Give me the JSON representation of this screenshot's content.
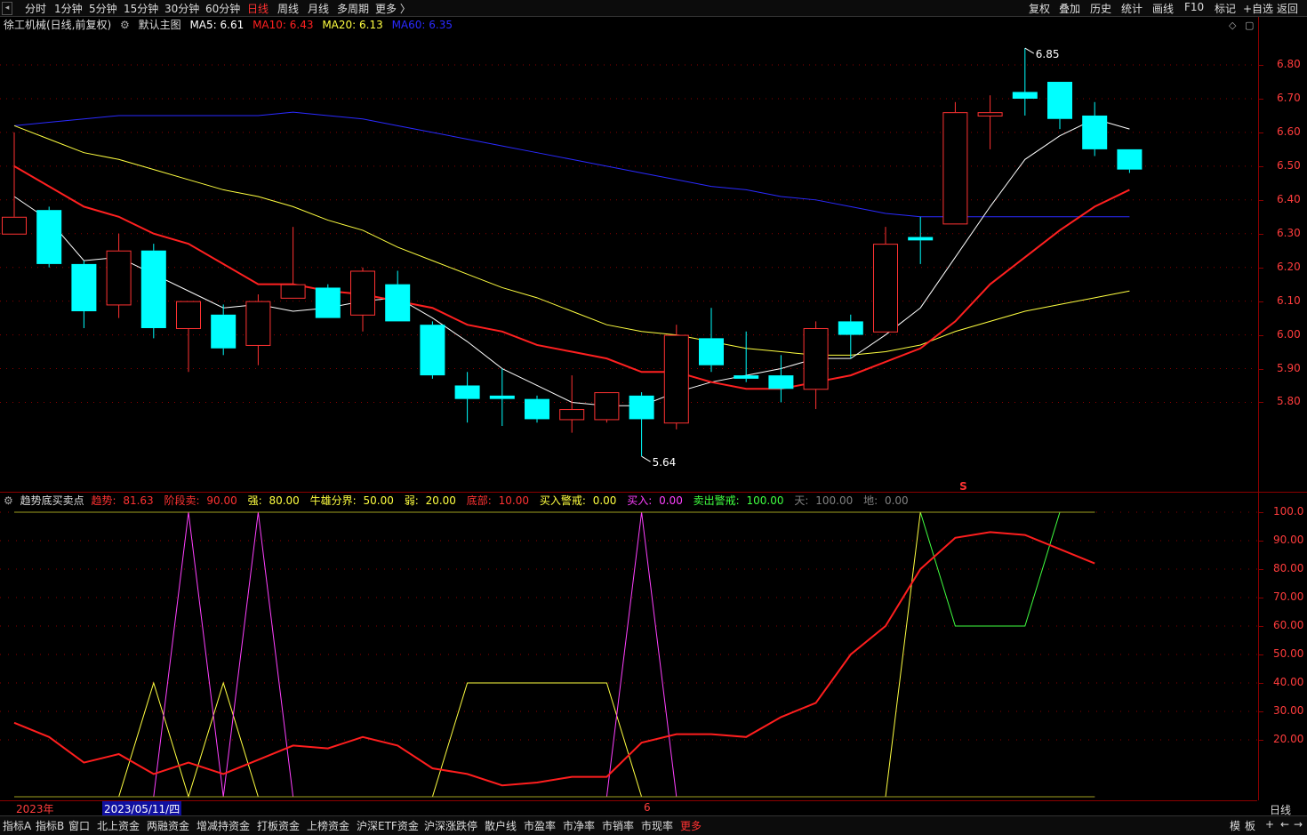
{
  "topbar": {
    "periods": [
      "分时",
      "1分钟",
      "5分钟",
      "15分钟",
      "30分钟",
      "60分钟",
      "日线",
      "周线",
      "月线",
      "多周期",
      "更多 〉"
    ],
    "active_period": "日线",
    "right_tools": [
      "复权",
      "叠加",
      "历史",
      "统计",
      "画线",
      "F10",
      "标记",
      "+自选",
      "返回"
    ]
  },
  "main_info": {
    "stock_title": "徐工机械(日线,前复权)",
    "template_label": "默认主图",
    "ma5": "MA5: 6.61",
    "ma10": "MA10: 6.43",
    "ma20": "MA20: 6.13",
    "ma60": "MA60: 6.35"
  },
  "colors": {
    "up": "#ff3232",
    "down": "#00ffff",
    "ma5": "#ffffff",
    "ma10": "#ff2020",
    "ma20": "#ffff40",
    "ma60": "#2a2aff",
    "grid": "#8b0000",
    "axis_text": "#ff3c3c"
  },
  "price_axis": {
    "labels": [
      "6.80",
      "6.70",
      "6.60",
      "6.50",
      "6.40",
      "6.30",
      "6.20",
      "6.10",
      "6.00",
      "5.90",
      "5.80"
    ],
    "high_marker": "6.85",
    "low_marker": "5.64",
    "signal_mark": "S"
  },
  "chart_data": {
    "type": "candlestick",
    "x_label_start": "2023年",
    "x_cursor_date": "2023/05/11/四",
    "x_month_mark": "6",
    "candles": [
      {
        "o": 6.3,
        "h": 6.6,
        "l": 6.3,
        "c": 6.35
      },
      {
        "o": 6.37,
        "h": 6.38,
        "l": 6.2,
        "c": 6.21
      },
      {
        "o": 6.21,
        "h": 6.22,
        "l": 6.02,
        "c": 6.07
      },
      {
        "o": 6.09,
        "h": 6.3,
        "l": 6.05,
        "c": 6.25
      },
      {
        "o": 6.25,
        "h": 6.27,
        "l": 5.99,
        "c": 6.02
      },
      {
        "o": 6.02,
        "h": 6.1,
        "l": 5.89,
        "c": 6.1
      },
      {
        "o": 6.06,
        "h": 6.09,
        "l": 5.94,
        "c": 5.96
      },
      {
        "o": 5.97,
        "h": 6.12,
        "l": 5.91,
        "c": 6.1
      },
      {
        "o": 6.11,
        "h": 6.32,
        "l": 6.11,
        "c": 6.15
      },
      {
        "o": 6.14,
        "h": 6.15,
        "l": 6.05,
        "c": 6.05
      },
      {
        "o": 6.06,
        "h": 6.2,
        "l": 6.01,
        "c": 6.19
      },
      {
        "o": 6.15,
        "h": 6.19,
        "l": 6.04,
        "c": 6.04
      },
      {
        "o": 6.03,
        "h": 6.04,
        "l": 5.87,
        "c": 5.88
      },
      {
        "o": 5.85,
        "h": 5.89,
        "l": 5.74,
        "c": 5.81
      },
      {
        "o": 5.82,
        "h": 5.9,
        "l": 5.73,
        "c": 5.81
      },
      {
        "o": 5.81,
        "h": 5.82,
        "l": 5.74,
        "c": 5.75
      },
      {
        "o": 5.75,
        "h": 5.88,
        "l": 5.71,
        "c": 5.78
      },
      {
        "o": 5.75,
        "h": 5.83,
        "l": 5.74,
        "c": 5.83
      },
      {
        "o": 5.82,
        "h": 5.83,
        "l": 5.64,
        "c": 5.75
      },
      {
        "o": 5.74,
        "h": 6.03,
        "l": 5.72,
        "c": 6.0
      },
      {
        "o": 5.99,
        "h": 6.08,
        "l": 5.89,
        "c": 5.91
      },
      {
        "o": 5.88,
        "h": 6.01,
        "l": 5.86,
        "c": 5.87
      },
      {
        "o": 5.88,
        "h": 5.94,
        "l": 5.8,
        "c": 5.84
      },
      {
        "o": 5.84,
        "h": 6.04,
        "l": 5.78,
        "c": 6.02
      },
      {
        "o": 6.04,
        "h": 6.06,
        "l": 5.93,
        "c": 6.0
      },
      {
        "o": 6.01,
        "h": 6.32,
        "l": 6.01,
        "c": 6.27
      },
      {
        "o": 6.29,
        "h": 6.35,
        "l": 6.21,
        "c": 6.28
      },
      {
        "o": 6.33,
        "h": 6.69,
        "l": 6.33,
        "c": 6.66
      },
      {
        "o": 6.65,
        "h": 6.71,
        "l": 6.55,
        "c": 6.66
      },
      {
        "o": 6.72,
        "h": 6.85,
        "l": 6.65,
        "c": 6.7
      },
      {
        "o": 6.75,
        "h": 6.75,
        "l": 6.61,
        "c": 6.64
      },
      {
        "o": 6.65,
        "h": 6.69,
        "l": 6.53,
        "c": 6.55
      },
      {
        "o": 6.55,
        "h": 6.55,
        "l": 6.48,
        "c": 6.49
      }
    ],
    "ma5": [
      6.41,
      6.34,
      6.22,
      6.23,
      6.18,
      6.13,
      6.08,
      6.09,
      6.07,
      6.08,
      6.1,
      6.11,
      6.05,
      5.98,
      5.9,
      5.85,
      5.8,
      5.79,
      5.79,
      5.83,
      5.86,
      5.88,
      5.9,
      5.93,
      5.93,
      6.0,
      6.08,
      6.23,
      6.38,
      6.52,
      6.59,
      6.64,
      6.61
    ],
    "ma10": [
      6.5,
      6.44,
      6.38,
      6.35,
      6.3,
      6.27,
      6.21,
      6.15,
      6.15,
      6.13,
      6.12,
      6.1,
      6.08,
      6.03,
      6.01,
      5.97,
      5.95,
      5.93,
      5.89,
      5.89,
      5.86,
      5.84,
      5.84,
      5.86,
      5.88,
      5.92,
      5.96,
      6.04,
      6.15,
      6.23,
      6.31,
      6.38,
      6.43
    ],
    "ma20": [
      6.62,
      6.58,
      6.54,
      6.52,
      6.49,
      6.46,
      6.43,
      6.41,
      6.38,
      6.34,
      6.31,
      6.26,
      6.22,
      6.18,
      6.14,
      6.11,
      6.07,
      6.03,
      6.01,
      6.0,
      5.98,
      5.96,
      5.95,
      5.94,
      5.94,
      5.95,
      5.97,
      6.01,
      6.04,
      6.07,
      6.09,
      6.11,
      6.13
    ],
    "ma60": [
      6.62,
      6.63,
      6.64,
      6.65,
      6.65,
      6.65,
      6.65,
      6.65,
      6.66,
      6.65,
      6.64,
      6.62,
      6.6,
      6.58,
      6.56,
      6.54,
      6.52,
      6.5,
      6.48,
      6.46,
      6.44,
      6.43,
      6.41,
      6.4,
      6.38,
      6.36,
      6.35,
      6.35,
      6.35,
      6.35,
      6.35,
      6.35,
      6.35
    ],
    "price_range": [
      5.535,
      6.895
    ],
    "indicator": {
      "range": [
        0,
        100
      ],
      "trend": [
        26,
        21,
        12,
        15,
        8,
        12,
        8,
        13,
        18,
        17,
        21,
        18,
        10,
        8,
        4,
        5,
        7,
        7,
        19,
        22,
        22,
        21,
        28,
        33,
        50,
        60,
        80,
        91,
        93,
        92,
        87,
        82
      ],
      "yellow": [
        0,
        0,
        0,
        0,
        40,
        0,
        40,
        0,
        0,
        0,
        0,
        0,
        0,
        40,
        40,
        40,
        40,
        40,
        0,
        0,
        0,
        0,
        0,
        0,
        0,
        0,
        100,
        100,
        100,
        100,
        100,
        100
      ],
      "magenta": [
        0,
        0,
        0,
        0,
        0,
        100,
        0,
        100,
        0,
        0,
        0,
        0,
        0,
        0,
        0,
        0,
        0,
        0,
        100,
        0,
        0,
        0,
        0,
        0,
        0,
        0,
        0,
        0,
        0,
        0,
        0,
        0
      ],
      "green": [
        100,
        100,
        100,
        100,
        100,
        100,
        100,
        100,
        100,
        100,
        100,
        100,
        100,
        100,
        100,
        100,
        100,
        100,
        100,
        100,
        100,
        100,
        100,
        100,
        100,
        100,
        100,
        60,
        60,
        60,
        100,
        100
      ]
    }
  },
  "indicator_info": {
    "name": "趋势底买卖点",
    "trend_label": "趋势:",
    "trend_value": "81.63",
    "stage_sell_label": "阶段卖:",
    "stage_sell_value": "90.00",
    "strong_label": "强:",
    "strong_value": "80.00",
    "bull_bear_label": "牛雄分界:",
    "bull_bear_value": "50.00",
    "weak_label": "弱:",
    "weak_value": "20.00",
    "bottom_label": "底部:",
    "bottom_value": "10.00",
    "buy_alert_label": "买入警戒:",
    "buy_alert_value": "0.00",
    "buy_label": "买入:",
    "buy_value": "0.00",
    "sell_alert_label": "卖出警戒:",
    "sell_alert_value": "100.00",
    "sky_label": "天:",
    "sky_value": "100.00",
    "ground_label": "地:",
    "ground_value": "0.00"
  },
  "indicator_axis": {
    "labels": [
      "100.0",
      "90.00",
      "80.00",
      "70.00",
      "60.00",
      "50.00",
      "40.00",
      "30.00",
      "20.00"
    ]
  },
  "axis_footer": {
    "period": "日线"
  },
  "bottom_tabs": {
    "items": [
      "指标A",
      "指标B",
      "窗口",
      "北上资金",
      "两融资金",
      "增减持资金",
      "打板资金",
      "上榜资金",
      "沪深ETF资金",
      "沪深涨跌停",
      "散户线",
      "市盈率",
      "市净率",
      "市销率",
      "市现率",
      "更多"
    ],
    "active": "更多",
    "right_items": [
      "模",
      "板",
      "+",
      "←",
      "→"
    ]
  }
}
